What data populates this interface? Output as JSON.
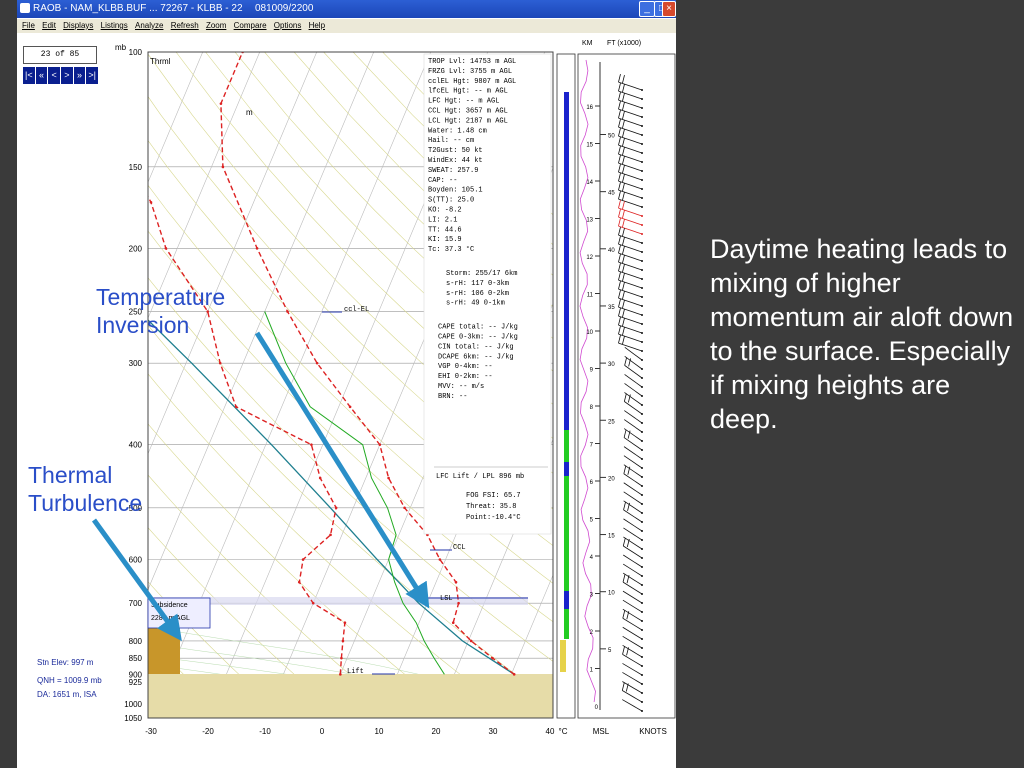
{
  "window": {
    "title": "RAOB - NAM_KLBB.BUF ... 72267 - KLBB - 22",
    "title_date": "081009/2200",
    "menu": [
      "File",
      "Edit",
      "Displays",
      "Listings",
      "Analyze",
      "Refresh",
      "Zoom",
      "Compare",
      "Options",
      "Help"
    ]
  },
  "nav": {
    "counter": "23 of 85",
    "buttons": [
      "|<",
      "«",
      "<",
      ">",
      "»",
      ">|"
    ]
  },
  "station": {
    "elev": "Stn Elev: 997 m",
    "qnh": "QNH = 1009.9 mb",
    "da": "DA: 1651 m, ISA"
  },
  "annotations": {
    "inversion_line1": "Temperature",
    "inversion_line2": "Inversion",
    "thermal_line1": "Thermal",
    "thermal_line2": "Turbulence",
    "subsidence_line1": "Subsidence",
    "subsidence_line2": "2287 m AGL",
    "thrml": "Thrml",
    "m_label": "m",
    "ccl_el": "ccl-EL",
    "ccl": "CCL",
    "lsl": "LSL",
    "lift": "Lift"
  },
  "note": "Daytime heating leads to mixing of higher momentum air aloft down to the surface. Especially if mixing heights are deep.",
  "params": [
    "TROP Lvl: 14753 m AGL",
    "FRZG Lvl:  3755 m AGL",
    " cclEL Hgt:  9807 m AGL",
    "lfcEL Hgt:    -- m AGL",
    " LFC Hgt:    -- m AGL",
    " CCL Hgt:  3657 m AGL",
    " LCL Hgt:  2187 m AGL",
    "   Water:  1.48 cm",
    "    Hail:    -- cm",
    " T2Gust:    50 kt",
    " WindEx:    44 kt",
    "  SWEAT: 257.9",
    "    CAP:    --",
    " Boyden: 105.1",
    "  S(TT):  25.0",
    "     KO:  -8.2",
    "     LI:   2.1",
    "     TT:  44.6",
    "     KI:  15.9",
    "     Tc:  37.3 °C"
  ],
  "params2": [
    "Storm: 255/17  6km",
    " s-rH:  117  0-3km",
    " s-rH:  106  0-2km",
    " s-rH:   49  0-1km"
  ],
  "params3": [
    "CAPE total:   -- J/kg",
    "CAPE 0-3km:   -- J/kg",
    " CIN total:   -- J/kg",
    " DCAPE 6km:   -- J/kg",
    "  VGP 0-4km:   --",
    "  EHI 0-2km:   --",
    "       MVV:   -- m/s",
    "       BRN:   --"
  ],
  "lfc_line": "LFC Lift / LPL 896 mb",
  "params4": [
    "FOG FSI: 65.7",
    " Threat: 35.8",
    "  Point:-10.4°C"
  ],
  "colors": {
    "temp": "#dd2222",
    "dew": "#dd2222",
    "parcel": "#1f7f8f",
    "arrow": "#2a8fc8",
    "wetbulb": "#22aa22"
  },
  "chart_data": {
    "type": "skew-t log-p sounding",
    "pressure_axis_label": "mb",
    "pressure_ticks": [
      100,
      150,
      200,
      250,
      300,
      400,
      500,
      600,
      700,
      800,
      850,
      900,
      925,
      1000,
      1050
    ],
    "temp_axis_label": "°C",
    "temp_ticks": [
      -30,
      -20,
      -10,
      0,
      10,
      20,
      30,
      40
    ],
    "height_km_label": "KM",
    "height_ft_label": "FT (x1000)",
    "height_km_ticks": [
      1,
      2,
      3,
      4,
      5,
      6,
      7,
      8,
      9,
      10,
      11,
      12,
      13,
      14,
      15,
      16
    ],
    "height_ft_ticks": [
      5,
      10,
      15,
      20,
      25,
      30,
      35,
      40,
      45,
      50
    ],
    "msl_label": "MSL",
    "knots_label": "KNOTS",
    "temperature": [
      {
        "p": 900,
        "t": 30.5
      },
      {
        "p": 850,
        "t": 25.5
      },
      {
        "p": 800,
        "t": 20.5
      },
      {
        "p": 750,
        "t": 16.0
      },
      {
        "p": 700,
        "t": 15.5
      },
      {
        "p": 650,
        "t": 13.5
      },
      {
        "p": 600,
        "t": 9.0
      },
      {
        "p": 550,
        "t": 5.0
      },
      {
        "p": 500,
        "t": -1.0
      },
      {
        "p": 450,
        "t": -6.0
      },
      {
        "p": 400,
        "t": -10.0
      },
      {
        "p": 350,
        "t": -18.0
      },
      {
        "p": 300,
        "t": -27.0
      },
      {
        "p": 250,
        "t": -36.0
      },
      {
        "p": 200,
        "t": -46.0
      },
      {
        "p": 150,
        "t": -58.0
      },
      {
        "p": 120,
        "t": -63.0
      },
      {
        "p": 100,
        "t": -63.0
      }
    ],
    "dewpoint": [
      {
        "p": 900,
        "t": 0.0
      },
      {
        "p": 850,
        "t": -1.0
      },
      {
        "p": 800,
        "t": -2.0
      },
      {
        "p": 750,
        "t": -3.0
      },
      {
        "p": 700,
        "t": -10.0
      },
      {
        "p": 650,
        "t": -14.0
      },
      {
        "p": 600,
        "t": -15.0
      },
      {
        "p": 550,
        "t": -12.0
      },
      {
        "p": 500,
        "t": -13.0
      },
      {
        "p": 450,
        "t": -18.0
      },
      {
        "p": 400,
        "t": -22.0
      },
      {
        "p": 350,
        "t": -38.0
      },
      {
        "p": 300,
        "t": -44.0
      },
      {
        "p": 250,
        "t": -50.0
      },
      {
        "p": 200,
        "t": -62.0
      },
      {
        "p": 170,
        "t": -68.0
      },
      {
        "p": 150,
        "t": -74.0
      },
      {
        "p": 130,
        "t": -77.0
      }
    ],
    "parcel": [
      {
        "p": 900,
        "t": 30.5
      },
      {
        "p": 800,
        "t": 19.0
      },
      {
        "p": 700,
        "t": 8.5
      },
      {
        "p": 600,
        "t": -2.0
      },
      {
        "p": 500,
        "t": -14.0
      },
      {
        "p": 400,
        "t": -29.0
      },
      {
        "p": 300,
        "t": -49.0
      },
      {
        "p": 250,
        "t": -62.0
      },
      {
        "p": 200,
        "t": -76.0
      },
      {
        "p": 150,
        "t": -94.0
      },
      {
        "p": 120,
        "t": -106.0
      }
    ]
  }
}
